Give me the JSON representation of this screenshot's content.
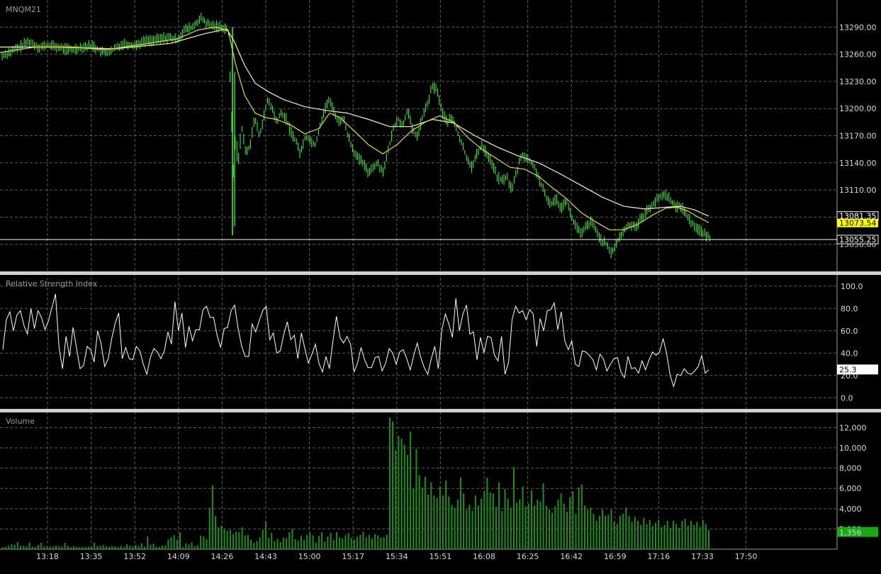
{
  "colors": {
    "background": "#000000",
    "grid": "#5a5a5a",
    "bar": "#3cff3c",
    "ma_fast": "#e6d84a",
    "ma_slow": "#f2efd8",
    "rsi_line": "#ffffff",
    "volume_bar": "#1d8f1d",
    "separator": "#d0d0d0",
    "label_badge_current": "#ffff00"
  },
  "chart_data": [
    {
      "type": "ohlc",
      "title": "MNQM21",
      "ylim": [
        13020,
        13320
      ],
      "y_ticks": [
        "13290.00",
        "13260.00",
        "13230.00",
        "13200.00",
        "13170.00",
        "13140.00",
        "13110.00",
        "13080.00",
        "13050.00"
      ],
      "x_ticks": [
        "13:18",
        "13:35",
        "13:52",
        "14:09",
        "14:26",
        "14:43",
        "15:00",
        "15:17",
        "15:34",
        "15:51",
        "16:08",
        "16:25",
        "16:42",
        "16:59",
        "17:16",
        "17:33",
        "17:50"
      ],
      "price_labels": [
        {
          "text": "13081.35",
          "value": 13081.35,
          "style": "ma_slow"
        },
        {
          "text": "13073.54",
          "value": 13073.54,
          "style": "ma_fast"
        },
        {
          "text": "13055.25",
          "value": 13055.25,
          "style": "current"
        }
      ],
      "current_price": 13055.25,
      "path_points": [
        [
          0,
          13257
        ],
        [
          25,
          13267
        ],
        [
          40,
          13274
        ],
        [
          55,
          13268
        ],
        [
          70,
          13270
        ],
        [
          85,
          13267
        ],
        [
          100,
          13265
        ],
        [
          115,
          13268
        ],
        [
          130,
          13270
        ],
        [
          145,
          13262
        ],
        [
          155,
          13262
        ],
        [
          165,
          13268
        ],
        [
          175,
          13272
        ],
        [
          190,
          13270
        ],
        [
          205,
          13275
        ],
        [
          220,
          13276
        ],
        [
          235,
          13279
        ],
        [
          250,
          13276
        ],
        [
          260,
          13287
        ],
        [
          272,
          13290
        ],
        [
          283,
          13300
        ],
        [
          295,
          13292
        ],
        [
          310,
          13291
        ],
        [
          322,
          13288
        ],
        [
          327,
          13185
        ],
        [
          328,
          13100
        ],
        [
          331,
          13170
        ],
        [
          336,
          13140
        ],
        [
          341,
          13180
        ],
        [
          347,
          13150
        ],
        [
          353,
          13160
        ],
        [
          359,
          13190
        ],
        [
          366,
          13170
        ],
        [
          372,
          13190
        ],
        [
          378,
          13210
        ],
        [
          384,
          13200
        ],
        [
          390,
          13185
        ],
        [
          397,
          13195
        ],
        [
          403,
          13190
        ],
        [
          410,
          13175
        ],
        [
          417,
          13165
        ],
        [
          424,
          13150
        ],
        [
          431,
          13170
        ],
        [
          438,
          13165
        ],
        [
          445,
          13160
        ],
        [
          451,
          13180
        ],
        [
          457,
          13195
        ],
        [
          463,
          13210
        ],
        [
          470,
          13200
        ],
        [
          477,
          13185
        ],
        [
          484,
          13190
        ],
        [
          491,
          13170
        ],
        [
          498,
          13155
        ],
        [
          505,
          13145
        ],
        [
          512,
          13140
        ],
        [
          519,
          13130
        ],
        [
          526,
          13135
        ],
        [
          533,
          13140
        ],
        [
          540,
          13130
        ],
        [
          547,
          13150
        ],
        [
          554,
          13175
        ],
        [
          561,
          13190
        ],
        [
          568,
          13180
        ],
        [
          575,
          13200
        ],
        [
          582,
          13175
        ],
        [
          589,
          13170
        ],
        [
          596,
          13190
        ],
        [
          603,
          13205
        ],
        [
          610,
          13225
        ],
        [
          617,
          13220
        ],
        [
          624,
          13195
        ],
        [
          631,
          13185
        ],
        [
          638,
          13190
        ],
        [
          645,
          13175
        ],
        [
          652,
          13160
        ],
        [
          659,
          13145
        ],
        [
          666,
          13135
        ],
        [
          673,
          13150
        ],
        [
          680,
          13160
        ],
        [
          687,
          13150
        ],
        [
          694,
          13140
        ],
        [
          701,
          13125
        ],
        [
          708,
          13120
        ],
        [
          715,
          13125
        ],
        [
          722,
          13110
        ],
        [
          729,
          13130
        ],
        [
          736,
          13150
        ],
        [
          743,
          13145
        ],
        [
          750,
          13140
        ],
        [
          757,
          13130
        ],
        [
          764,
          13115
        ],
        [
          771,
          13100
        ],
        [
          778,
          13095
        ],
        [
          785,
          13100
        ],
        [
          792,
          13090
        ],
        [
          799,
          13100
        ],
        [
          806,
          13080
        ],
        [
          813,
          13070
        ],
        [
          820,
          13060
        ],
        [
          827,
          13070
        ],
        [
          834,
          13075
        ],
        [
          841,
          13065
        ],
        [
          848,
          13055
        ],
        [
          855,
          13050
        ],
        [
          862,
          13040
        ],
        [
          869,
          13050
        ],
        [
          876,
          13060
        ],
        [
          883,
          13068
        ],
        [
          890,
          13072
        ],
        [
          897,
          13070
        ],
        [
          904,
          13078
        ],
        [
          911,
          13085
        ],
        [
          918,
          13092
        ],
        [
          925,
          13098
        ],
        [
          932,
          13103
        ],
        [
          939,
          13105
        ],
        [
          946,
          13100
        ],
        [
          953,
          13090
        ],
        [
          960,
          13093
        ],
        [
          967,
          13085
        ],
        [
          974,
          13075
        ],
        [
          981,
          13070
        ],
        [
          988,
          13065
        ],
        [
          995,
          13060
        ],
        [
          1002,
          13058
        ]
      ],
      "ma_fast_points": [
        [
          0,
          13262
        ],
        [
          50,
          13268
        ],
        [
          100,
          13268
        ],
        [
          150,
          13265
        ],
        [
          200,
          13271
        ],
        [
          250,
          13277
        ],
        [
          280,
          13287
        ],
        [
          305,
          13290
        ],
        [
          322,
          13286
        ],
        [
          332,
          13250
        ],
        [
          345,
          13215
        ],
        [
          360,
          13195
        ],
        [
          375,
          13190
        ],
        [
          390,
          13188
        ],
        [
          410,
          13182
        ],
        [
          430,
          13172
        ],
        [
          450,
          13178
        ],
        [
          465,
          13195
        ],
        [
          480,
          13190
        ],
        [
          500,
          13175
        ],
        [
          520,
          13160
        ],
        [
          540,
          13150
        ],
        [
          560,
          13160
        ],
        [
          580,
          13175
        ],
        [
          600,
          13185
        ],
        [
          620,
          13192
        ],
        [
          640,
          13185
        ],
        [
          660,
          13168
        ],
        [
          680,
          13155
        ],
        [
          700,
          13145
        ],
        [
          720,
          13135
        ],
        [
          740,
          13133
        ],
        [
          760,
          13125
        ],
        [
          780,
          13112
        ],
        [
          800,
          13100
        ],
        [
          820,
          13085
        ],
        [
          840,
          13075
        ],
        [
          860,
          13066
        ],
        [
          880,
          13066
        ],
        [
          900,
          13072
        ],
        [
          920,
          13082
        ],
        [
          940,
          13090
        ],
        [
          955,
          13091
        ],
        [
          970,
          13087
        ],
        [
          985,
          13080
        ],
        [
          1000,
          13074
        ]
      ],
      "ma_slow_points": [
        [
          0,
          13268
        ],
        [
          80,
          13268
        ],
        [
          160,
          13266
        ],
        [
          240,
          13272
        ],
        [
          290,
          13283
        ],
        [
          320,
          13288
        ],
        [
          330,
          13275
        ],
        [
          345,
          13248
        ],
        [
          360,
          13228
        ],
        [
          380,
          13218
        ],
        [
          400,
          13210
        ],
        [
          430,
          13202
        ],
        [
          460,
          13198
        ],
        [
          490,
          13195
        ],
        [
          520,
          13188
        ],
        [
          550,
          13180
        ],
        [
          580,
          13180
        ],
        [
          610,
          13188
        ],
        [
          640,
          13184
        ],
        [
          670,
          13170
        ],
        [
          700,
          13158
        ],
        [
          730,
          13148
        ],
        [
          760,
          13140
        ],
        [
          790,
          13128
        ],
        [
          820,
          13115
        ],
        [
          850,
          13102
        ],
        [
          880,
          13092
        ],
        [
          910,
          13089
        ],
        [
          940,
          13091
        ],
        [
          960,
          13092
        ],
        [
          980,
          13088
        ],
        [
          1000,
          13081
        ]
      ]
    },
    {
      "type": "line",
      "title": "Relative Strength Index",
      "ylim": [
        -10,
        110
      ],
      "y_ticks": [
        "100.0",
        "80.0",
        "60.0",
        "40.0",
        "20.0",
        "0.0"
      ],
      "current_label": "25.3",
      "current_value": 25.3,
      "values": [
        43,
        70,
        77,
        60,
        74,
        78,
        65,
        57,
        80,
        62,
        78,
        72,
        61,
        69,
        81,
        93,
        45,
        26,
        55,
        37,
        63,
        44,
        26,
        29,
        46,
        43,
        32,
        60,
        48,
        28,
        35,
        53,
        67,
        76,
        35,
        45,
        35,
        34,
        46,
        42,
        30,
        21,
        36,
        44,
        41,
        35,
        42,
        59,
        48,
        86,
        60,
        76,
        45,
        64,
        51,
        61,
        61,
        79,
        82,
        72,
        72,
        56,
        45,
        62,
        63,
        78,
        83,
        62,
        46,
        37,
        37,
        66,
        59,
        69,
        78,
        82,
        52,
        58,
        40,
        42,
        57,
        68,
        52,
        56,
        35,
        58,
        44,
        31,
        39,
        48,
        31,
        23,
        37,
        26,
        51,
        73,
        54,
        49,
        55,
        48,
        23,
        31,
        45,
        34,
        27,
        27,
        36,
        37,
        24,
        31,
        44,
        40,
        30,
        41,
        43,
        35,
        25,
        38,
        49,
        36,
        27,
        21,
        35,
        46,
        26,
        61,
        75,
        66,
        54,
        89,
        60,
        75,
        83,
        57,
        59,
        34,
        54,
        40,
        55,
        54,
        38,
        33,
        55,
        21,
        32,
        70,
        82,
        76,
        78,
        70,
        79,
        75,
        46,
        71,
        60,
        78,
        79,
        85,
        61,
        77,
        51,
        43,
        51,
        30,
        28,
        42,
        41,
        38,
        34,
        25,
        39,
        35,
        24,
        30,
        35,
        36,
        23,
        18,
        37,
        26,
        27,
        22,
        33,
        25,
        34,
        41,
        38,
        41,
        53,
        40,
        20,
        10,
        21,
        20,
        26,
        22,
        21,
        24,
        28,
        38,
        22,
        25
      ]
    },
    {
      "type": "bar",
      "title": "Volume",
      "ylim": [
        0,
        13500
      ],
      "y_ticks": [
        "12,000",
        "10,000",
        "8,000",
        "6,000",
        "4,000",
        "2,000"
      ],
      "current_label": "1,356",
      "current_value": 1356,
      "values": [
        185,
        260,
        340,
        510,
        430,
        720,
        340,
        325,
        270,
        650,
        260,
        220,
        430,
        630,
        280,
        300,
        265,
        255,
        340,
        285,
        260,
        640,
        350,
        200,
        300,
        240,
        210,
        230,
        220,
        245,
        290,
        640,
        310,
        335,
        410,
        300,
        230,
        320,
        270,
        200,
        320,
        220,
        470,
        340,
        270,
        420,
        310,
        580,
        250,
        1250,
        450,
        545,
        250,
        250,
        340,
        370,
        970,
        1180,
        1380,
        930,
        1650,
        230,
        560,
        460,
        670,
        300,
        380,
        1340,
        1260,
        1000,
        4080,
        6300,
        3300,
        2150,
        2300,
        2010,
        1820,
        1900,
        1520,
        1720,
        1700,
        2150,
        1350,
        1420,
        940,
        620,
        810,
        1180,
        1900,
        2750,
        1120,
        1620,
        800,
        1020,
        710,
        1150,
        1100,
        1680,
        2020,
        980,
        840,
        1320,
        910,
        1430,
        1630,
        1370,
        660,
        1310,
        1680,
        750,
        1250,
        1610,
        920,
        1690,
        1160,
        1080,
        1390,
        1580,
        1120,
        960,
        1240,
        1400,
        1720,
        1180,
        1450,
        1050,
        1500,
        1380,
        1150,
        1200,
        1450,
        13000,
        12600,
        9800,
        11200,
        10900,
        10300,
        9300,
        11600,
        5950,
        9900,
        7300,
        6100,
        7150,
        5400,
        6600,
        5300,
        5080,
        6200,
        5300,
        6800,
        5200,
        4350,
        4100,
        4900,
        7100,
        5500,
        3900,
        4400,
        3800,
        5300,
        4300,
        4980,
        5750,
        7050,
        5600,
        5500,
        4200,
        6600,
        3800,
        5950,
        5000,
        4100,
        8100,
        4600,
        4900,
        6200,
        4200,
        4500,
        5800,
        4300,
        4900,
        4700,
        6500,
        4300,
        3900,
        3600,
        4200,
        4900,
        5500,
        4500,
        3700,
        5100,
        5700,
        3500,
        6100,
        6400,
        4300,
        3900,
        4100,
        3500,
        2800,
        3300,
        3900,
        3300,
        3400,
        3900,
        2700,
        2500,
        3300,
        3500,
        4100,
        3300,
        2700,
        3200,
        2800,
        2400,
        3100,
        2500,
        2900,
        2300,
        2600,
        2900,
        2200,
        2400,
        2800,
        2100,
        2800,
        2500,
        2100,
        2800,
        3000,
        2300,
        2800,
        2400,
        2700,
        2200,
        2900,
        2500,
        1900
      ]
    }
  ]
}
